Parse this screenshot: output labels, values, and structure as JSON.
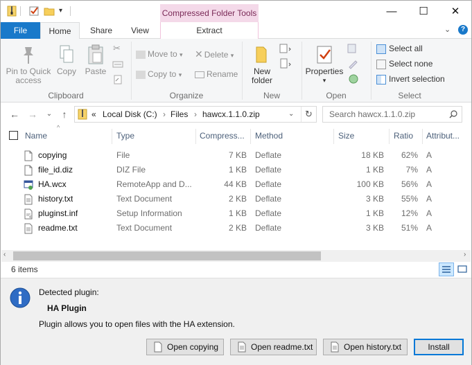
{
  "title_bar": {
    "context_tab_group": "Compressed Folder Tools",
    "minimize_glyph": "—",
    "maximize_glyph": "☐",
    "close_glyph": "✕"
  },
  "tabs": {
    "file": "File",
    "home": "Home",
    "share": "Share",
    "view": "View",
    "extract": "Extract"
  },
  "ribbon": {
    "clipboard": {
      "pin": "Pin to Quick access",
      "copy": "Copy",
      "paste": "Paste",
      "label": "Clipboard"
    },
    "organize": {
      "move_to": "Move to",
      "copy_to": "Copy to",
      "delete": "Delete",
      "rename": "Rename",
      "label": "Organize"
    },
    "new": {
      "new_folder": "New folder",
      "label": "New"
    },
    "open": {
      "properties": "Properties",
      "label": "Open"
    },
    "select": {
      "select_all": "Select all",
      "select_none": "Select none",
      "invert": "Invert selection",
      "label": "Select"
    }
  },
  "address": {
    "overflow": "«",
    "crumbs": [
      "Local Disk (C:)",
      "Files",
      "hawcx.1.1.0.zip"
    ],
    "search_placeholder": "Search hawcx.1.1.0.zip"
  },
  "columns": {
    "name": "Name",
    "type": "Type",
    "compressed": "Compress...",
    "method": "Method",
    "size": "Size",
    "ratio": "Ratio",
    "attributes": "Attribut..."
  },
  "files": [
    {
      "name": "copying",
      "type": "File",
      "compressed": "7 KB",
      "method": "Deflate",
      "size": "18 KB",
      "ratio": "62%",
      "attr": "A",
      "icon": "document-icon"
    },
    {
      "name": "file_id.diz",
      "type": "DIZ File",
      "compressed": "1 KB",
      "method": "Deflate",
      "size": "1 KB",
      "ratio": "7%",
      "attr": "A",
      "icon": "document-icon"
    },
    {
      "name": "HA.wcx",
      "type": "RemoteApp and D...",
      "compressed": "44 KB",
      "method": "Deflate",
      "size": "100 KB",
      "ratio": "56%",
      "attr": "A",
      "icon": "remoteapp-icon"
    },
    {
      "name": "history.txt",
      "type": "Text Document",
      "compressed": "2 KB",
      "method": "Deflate",
      "size": "3 KB",
      "ratio": "55%",
      "attr": "A",
      "icon": "text-file-icon"
    },
    {
      "name": "pluginst.inf",
      "type": "Setup Information",
      "compressed": "1 KB",
      "method": "Deflate",
      "size": "1 KB",
      "ratio": "12%",
      "attr": "A",
      "icon": "setup-file-icon"
    },
    {
      "name": "readme.txt",
      "type": "Text Document",
      "compressed": "2 KB",
      "method": "Deflate",
      "size": "3 KB",
      "ratio": "51%",
      "attr": "A",
      "icon": "text-file-icon"
    }
  ],
  "status": {
    "item_count": "6 items"
  },
  "plugin_panel": {
    "detected": "Detected plugin:",
    "plugin_name": "HA Plugin",
    "description": "Plugin allows you to open files with the HA extension.",
    "buttons": {
      "open_copying": "Open copying",
      "open_readme": "Open readme.txt",
      "open_history": "Open history.txt",
      "install": "Install"
    }
  },
  "colors": {
    "file_tab": "#1979ca",
    "context_tab": "#f4d9e9",
    "scroll_thumb": "#c2c2c2",
    "panel_bg": "#f0f0f0"
  }
}
